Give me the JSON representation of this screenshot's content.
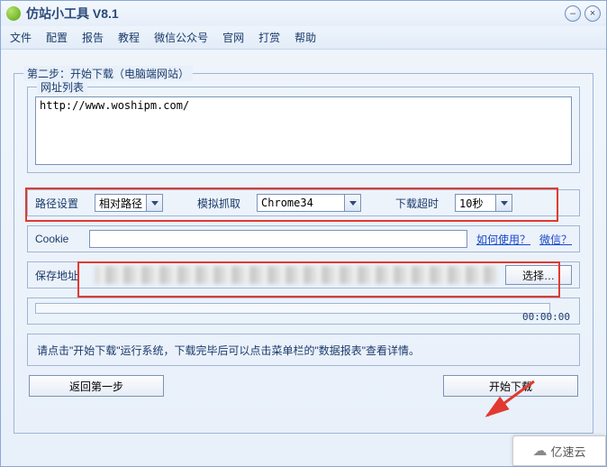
{
  "window": {
    "title": "仿站小工具 V8.1"
  },
  "menu": {
    "items": [
      "文件",
      "配置",
      "报告",
      "教程",
      "微信公众号",
      "官网",
      "打赏",
      "帮助"
    ]
  },
  "step": {
    "legend": "第二步：开始下载（电脑端网站）",
    "url_list_label": "网址列表",
    "url_value": "http://www.woshipm.com/"
  },
  "settings": {
    "path_label": "路径设置",
    "path_value": "相对路径",
    "crawl_label": "模拟抓取",
    "crawl_value": "Chrome34",
    "timeout_label": "下载超时",
    "timeout_value": "10秒"
  },
  "cookie": {
    "label": "Cookie",
    "value": "",
    "howto": "如何使用？",
    "wechat": "微信？"
  },
  "save": {
    "label": "保存地址",
    "browse": "选择…"
  },
  "progress": {
    "time": "00:00:00"
  },
  "hint": {
    "text": "请点击\"开始下载\"运行系统，下载完毕后可以点击菜单栏的\"数据报表\"查看详情。"
  },
  "buttons": {
    "back": "返回第一步",
    "start": "开始下载"
  },
  "watermark": {
    "text": "亿速云"
  }
}
